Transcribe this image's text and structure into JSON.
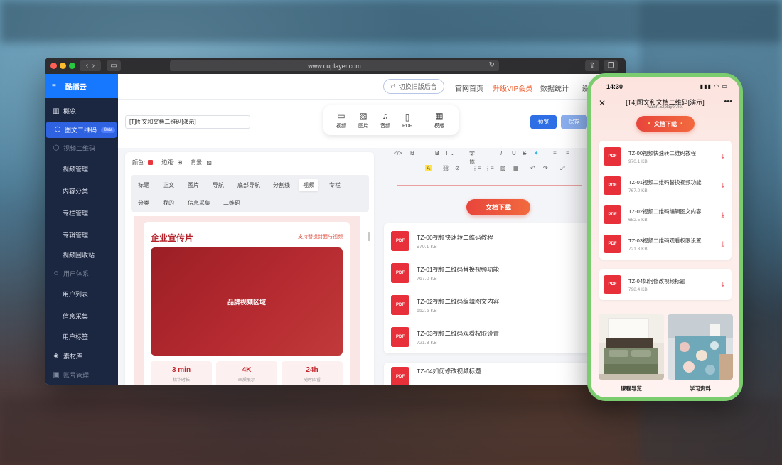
{
  "browser": {
    "url": "www.cuplayer.com"
  },
  "sidebar": {
    "logo": "酷播云",
    "items": [
      {
        "label": "概览",
        "icon": "chart-icon",
        "type": "item"
      },
      {
        "label": "图文二维码",
        "icon": "cube-icon",
        "type": "active",
        "badge": "Beta"
      },
      {
        "label": "视频二维码",
        "icon": "cube-icon",
        "type": "group"
      },
      {
        "label": "视频管理",
        "type": "sub"
      },
      {
        "label": "内容分类",
        "type": "sub"
      },
      {
        "label": "专栏管理",
        "type": "sub"
      },
      {
        "label": "专辑管理",
        "type": "sub"
      },
      {
        "label": "视频回收站",
        "type": "sub"
      },
      {
        "label": "用户体系",
        "icon": "user-icon",
        "type": "group"
      },
      {
        "label": "用户列表",
        "type": "sub"
      },
      {
        "label": "信息采集",
        "type": "sub"
      },
      {
        "label": "用户标签",
        "type": "sub"
      },
      {
        "label": "素材库",
        "icon": "layers-icon",
        "type": "item"
      },
      {
        "label": "账号管理",
        "icon": "id-icon",
        "type": "group"
      }
    ]
  },
  "topnav": {
    "switch": "切换旧版后台",
    "home": "官网首页",
    "vip": "升级VIP会员",
    "stats": "数据统计",
    "more": "设"
  },
  "toolbar": {
    "title_value": "[T]图文和文档二维码[演示]",
    "insert": [
      {
        "label": "视频",
        "icon": "video-icon"
      },
      {
        "label": "图片",
        "icon": "image-icon"
      },
      {
        "label": "音频",
        "icon": "music-icon"
      },
      {
        "label": "PDF",
        "icon": "file-icon"
      }
    ],
    "template": "模版",
    "preview": "预览",
    "save": "保存"
  },
  "config": {
    "color_label": "颜色:",
    "border_label": "边距:",
    "bg_label": "背景:",
    "tabs_row1": [
      "标题",
      "正文",
      "图片",
      "导航",
      "底部导航",
      "分割线",
      "视频",
      "专栏"
    ],
    "tabs_row2": [
      "分类",
      "我的",
      "信息采集",
      "二维码"
    ],
    "active_tab": "视频",
    "accent": "#e8383d"
  },
  "promo": {
    "title": "企业宣传片",
    "note": "支持替换封面与视频",
    "video_label": "品牌视频区域",
    "stats": [
      {
        "value": "3 min",
        "label": "精华时长"
      },
      {
        "value": "4K",
        "label": "画质展示"
      },
      {
        "value": "24h",
        "label": "随时回看"
      }
    ]
  },
  "editor": {
    "heading_select": "H",
    "font_select": "字体"
  },
  "documents": {
    "section_title": "文档下载",
    "items": [
      {
        "name": "TZ-00视频快速转二维码教程",
        "size": "970.1 KB"
      },
      {
        "name": "TZ-01视频二维码替换视频功能",
        "size": "767.0 KB"
      },
      {
        "name": "TZ-02视频二维码编辑图文内容",
        "size": "652.5 KB"
      },
      {
        "name": "TZ-03视频二维码观看权限设置",
        "size": "721.3 KB"
      },
      {
        "name": "TZ-04如何修改视频标题",
        "size": "798.4 KB"
      }
    ],
    "pdf_label": "PDF"
  },
  "phone": {
    "time": "14:30",
    "title": "[T4]图文和文档二维码[演示]",
    "domain": "watch.52player.net",
    "images": [
      {
        "label": "课程导览"
      },
      {
        "label": "学习资料"
      }
    ]
  }
}
